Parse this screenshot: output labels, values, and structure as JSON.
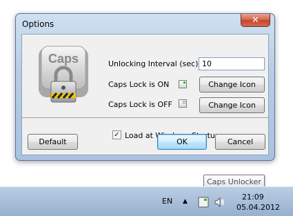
{
  "window": {
    "title": "Options",
    "close_glyph": "✕"
  },
  "settings": {
    "interval_label": "Unlocking Interval (sec)",
    "interval_value": "10",
    "caps_on_label": "Caps Lock is ON",
    "caps_off_label": "Caps Lock is OFF",
    "change_icon_label": "Change Icon",
    "startup_label": "Load at Windows Startup",
    "startup_checked": true,
    "on_indicator_color": "#2bb72b",
    "off_indicator_color": "#ffffff"
  },
  "caps_icon": {
    "key_text": "Caps"
  },
  "buttons": {
    "default": "Default",
    "ok": "OK",
    "cancel": "Cancel"
  },
  "taskbar": {
    "language": "EN",
    "time": "21:09",
    "date": "05.04.2012",
    "show_hidden_glyph": "▲"
  },
  "tooltip": {
    "text": "Caps Unlocker"
  }
}
